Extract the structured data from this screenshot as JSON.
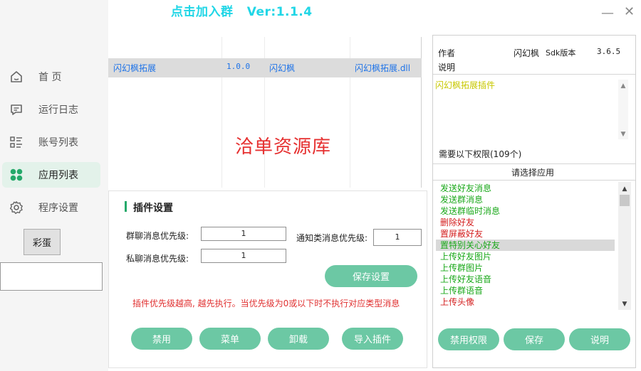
{
  "window": {
    "title": "点击加入群   Ver:1.1.4",
    "minimize": "—",
    "close": "✕"
  },
  "sidebar": {
    "items": [
      {
        "label": "首  页",
        "icon": "home-icon"
      },
      {
        "label": "运行日志",
        "icon": "message-icon"
      },
      {
        "label": "账号列表",
        "icon": "list-icon"
      },
      {
        "label": "应用列表",
        "icon": "apps-icon"
      },
      {
        "label": "程序设置",
        "icon": "gear-icon"
      }
    ],
    "egg_button": "彩蛋",
    "input_value": ""
  },
  "plugin_table": {
    "rows": [
      {
        "name": "闪幻枫拓展",
        "version": "1.0.0",
        "author": "闪幻枫",
        "file": "闪幻枫拓展.dll"
      }
    ],
    "watermark": "洽单资源库"
  },
  "settings": {
    "title": "插件设置",
    "group_label": "群聊消息优先级:",
    "group_value": "1",
    "notify_label": "通知类消息优先级:",
    "notify_value": "1",
    "private_label": "私聊消息优先级:",
    "private_value": "1",
    "save_button": "保存设置",
    "warning": "插件优先级越高, 越先执行。当优先级为0或以下时不执行对应类型消息",
    "buttons": [
      "禁用",
      "菜单",
      "卸载",
      "导入插件"
    ]
  },
  "info": {
    "author_label": "作者",
    "author_value": "闪幻枫",
    "sdk_label": "Sdk版本",
    "sdk_value": "3.6.5",
    "desc_label": "说明",
    "desc_value": "闪幻枫拓展插件",
    "permissions_label": "需要以下权限(109个)",
    "select_app_label": "请选择应用",
    "permissions": [
      {
        "text": "发送好友消息",
        "color": "#1aa81a"
      },
      {
        "text": "发送群消息",
        "color": "#1aa81a"
      },
      {
        "text": "发送群临时消息",
        "color": "#1aa81a"
      },
      {
        "text": "删除好友",
        "color": "#d42020"
      },
      {
        "text": "置屏蔽好友",
        "color": "#d42020"
      },
      {
        "text": "置特别关心好友",
        "color": "#1aa81a"
      },
      {
        "text": "上传好友图片",
        "color": "#1aa81a"
      },
      {
        "text": "上传群图片",
        "color": "#1aa81a"
      },
      {
        "text": "上传好友语音",
        "color": "#1aa81a"
      },
      {
        "text": "上传群语音",
        "color": "#1aa81a"
      },
      {
        "text": "上传头像",
        "color": "#d42020"
      }
    ],
    "selected_permission_index": 5,
    "buttons": [
      "禁用权限",
      "保存",
      "说明"
    ]
  },
  "colors": {
    "accent": "#6cc8a4",
    "title": "#20d6e6",
    "link": "#1e73e8",
    "warning": "#e03030"
  }
}
